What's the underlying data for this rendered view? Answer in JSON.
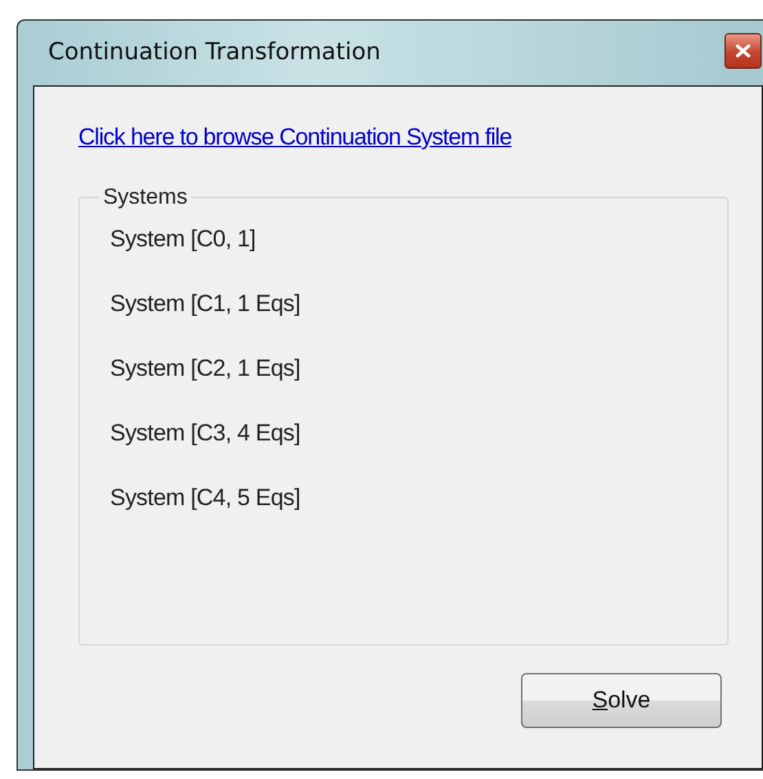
{
  "window": {
    "title": "Continuation Transformation"
  },
  "browse_link": "Click here to browse Continuation System file",
  "systems_group": {
    "title": "Systems",
    "items": [
      {
        "label": "System [C0, 1]"
      },
      {
        "label": "System [C1, 1 Eqs]"
      },
      {
        "label": "System [C2, 1 Eqs]"
      },
      {
        "label": "System [C3, 4 Eqs]"
      },
      {
        "label": "System [C4, 5 Eqs]"
      }
    ]
  },
  "buttons": [
    {
      "label_parts": [
        {
          "text": "S",
          "underlined": true
        },
        {
          "text": "olve",
          "underlined": false
        }
      ]
    }
  ]
}
